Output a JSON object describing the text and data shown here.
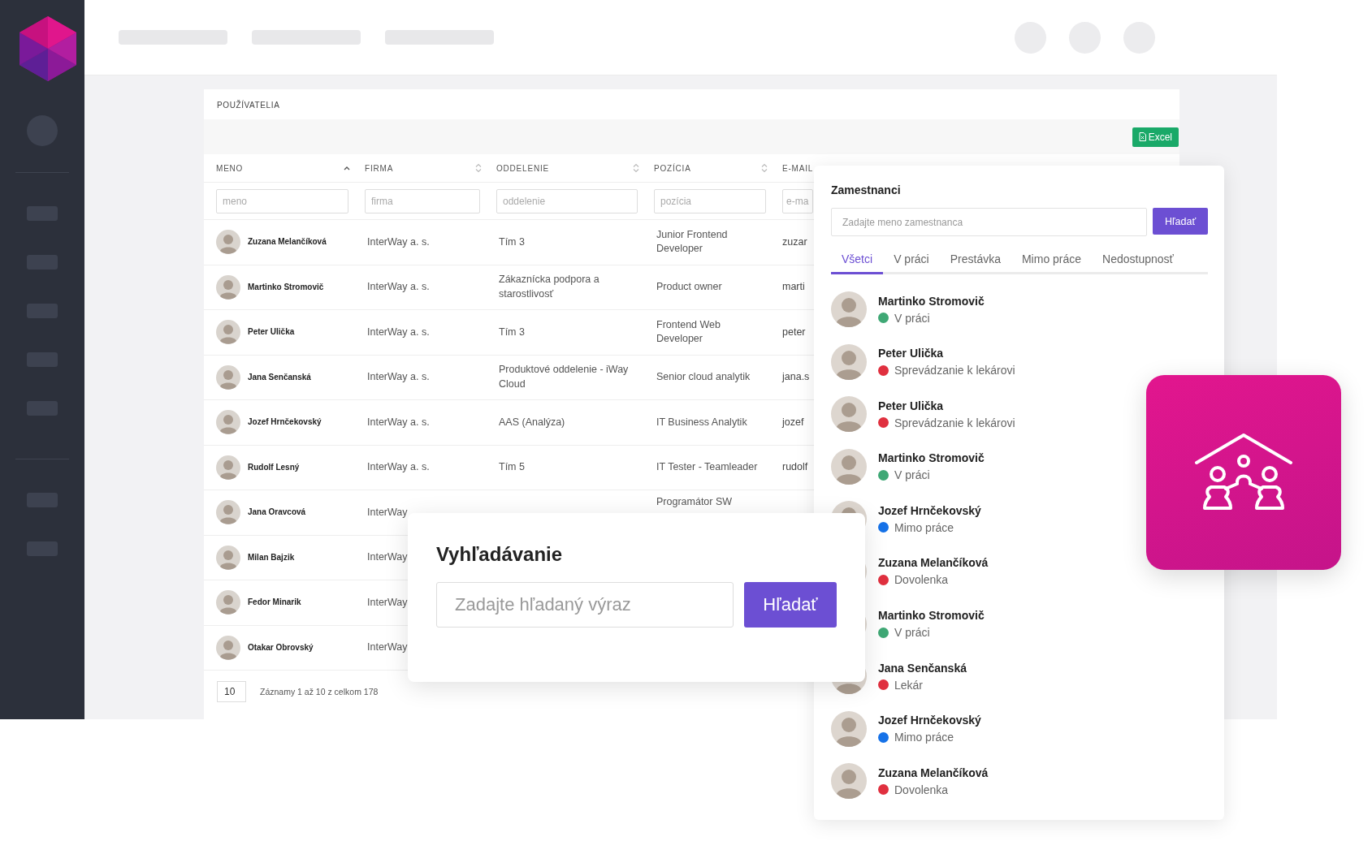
{
  "table": {
    "title": "POUŽÍVATELIA",
    "export_button": "Excel",
    "columns": [
      {
        "label": "MENO",
        "sorted": true,
        "placeholder": "meno"
      },
      {
        "label": "FIRMA",
        "sorted": false,
        "placeholder": "firma"
      },
      {
        "label": "ODDELENIE",
        "sorted": false,
        "placeholder": "oddelenie"
      },
      {
        "label": "POZÍCIA",
        "sorted": false,
        "placeholder": "pozícia"
      },
      {
        "label": "E-MAIL",
        "placeholder": "e-ma"
      }
    ],
    "rows": [
      {
        "name": "Zuzana Melančíková",
        "company": "InterWay a. s.",
        "department": "Tím 3",
        "position": "Junior Frontend Developer",
        "email": "zuzar"
      },
      {
        "name": "Martinko Stromovič",
        "company": "InterWay a. s.",
        "department": "Zákaznícka podpora a starostlivosť",
        "position": "Product owner",
        "email": "marti"
      },
      {
        "name": "Peter Ulička",
        "company": "InterWay a. s.",
        "department": "Tím 3",
        "position": "Frontend Web Developer",
        "email": "peter"
      },
      {
        "name": "Jana Senčanská",
        "company": "InterWay a. s.",
        "department": "Produktové oddelenie - iWay Cloud",
        "position": "Senior cloud analytik",
        "email": "jana.s"
      },
      {
        "name": "Jozef Hrnčekovský",
        "company": "InterWay a. s.",
        "department": "AAS (Analýza)",
        "position": "IT Business Analytik",
        "email": "jozef"
      },
      {
        "name": "Rudolf Lesný",
        "company": "InterWay a. s.",
        "department": "Tím 5",
        "position": "IT Tester - Teamleader",
        "email": "rudolf"
      },
      {
        "name": "Jana Oravcová",
        "company": "InterWay",
        "position": "Programátor SW"
      },
      {
        "name": "Milan Bajzik",
        "company": "InterWay"
      },
      {
        "name": "Fedor Minarik",
        "company": "InterWay"
      },
      {
        "name": "Otakar Obrovský",
        "company": "InterWay"
      }
    ],
    "page_size": "10",
    "summary": "Záznamy 1 až 10 z celkom 178"
  },
  "employees_panel": {
    "title": "Zamestnanci",
    "placeholder": "Zadajte meno zamestnanca",
    "button": "Hľadať",
    "tabs": [
      {
        "label": "Všetci",
        "selected": true
      },
      {
        "label": "V práci",
        "selected": false
      },
      {
        "label": "Prestávka",
        "selected": false
      },
      {
        "label": "Mimo práce",
        "selected": false
      },
      {
        "label": "Nedostupnosť",
        "selected": false
      }
    ],
    "employees": [
      {
        "name": "Martinko Stromovič",
        "status": "V práci",
        "color": "#3fa875"
      },
      {
        "name": "Peter Ulička",
        "status": "Sprevádzanie k lekárovi",
        "color": "#e0303f"
      },
      {
        "name": "Peter Ulička",
        "status": "Sprevádzanie k lekárovi",
        "color": "#e0303f"
      },
      {
        "name": "Martinko Stromovič",
        "status": "V práci",
        "color": "#3fa875"
      },
      {
        "name": "Jozef Hrnčekovský",
        "status": "Mimo práce",
        "color": "#1672e8"
      },
      {
        "name": "Zuzana Melančíková",
        "status": "Dovolenka",
        "color": "#e0303f"
      },
      {
        "name": "Martinko Stromovič",
        "status": "V práci",
        "color": "#3fa875"
      },
      {
        "name": "Jana Senčanská",
        "status": "Lekár",
        "color": "#e0303f"
      },
      {
        "name": "Jozef Hrnčekovský",
        "status": "Mimo práce",
        "color": "#1672e8"
      },
      {
        "name": "Zuzana Melančíková",
        "status": "Dovolenka",
        "color": "#e0303f"
      }
    ]
  },
  "search_dialog": {
    "title": "Vyhľadávanie",
    "placeholder": "Zadajte hľadaný výraz",
    "button": "Hľadať"
  }
}
